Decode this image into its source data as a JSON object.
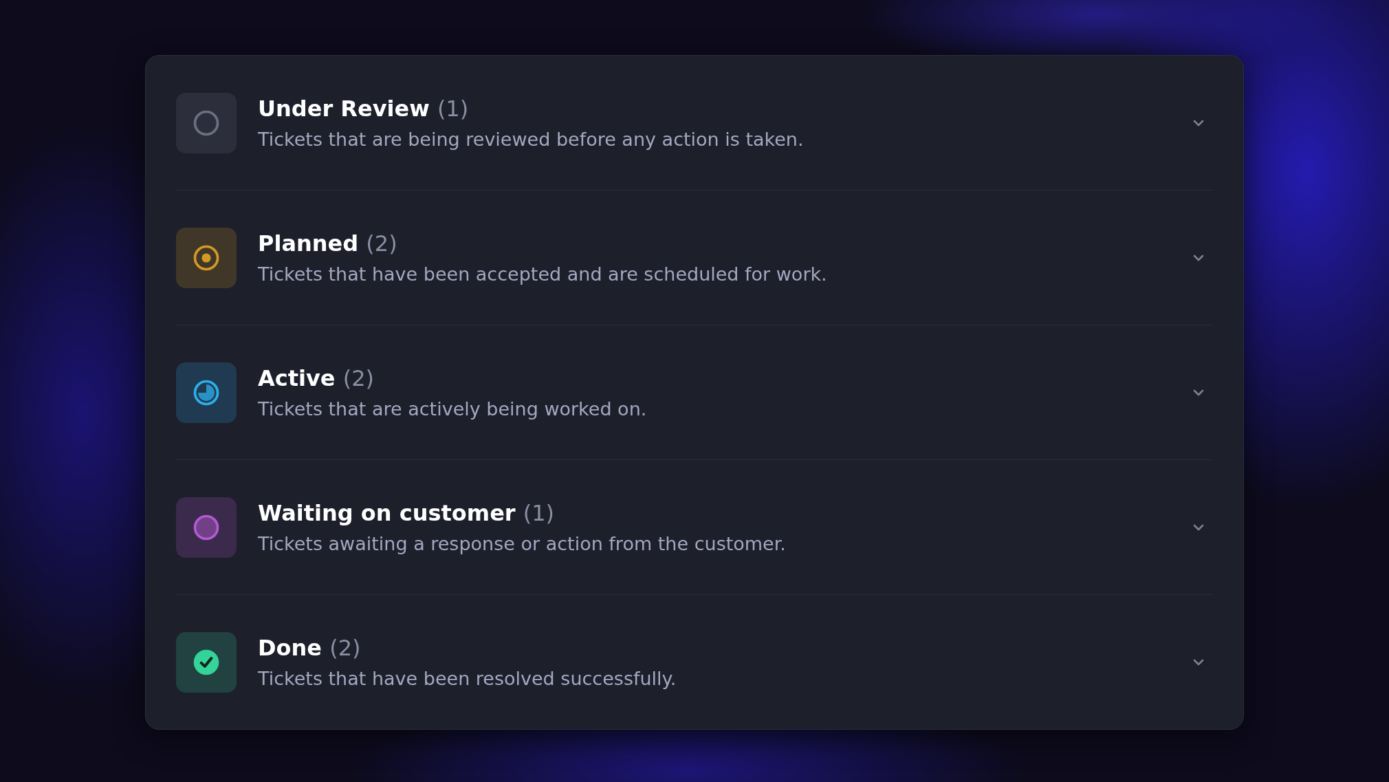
{
  "statuses": [
    {
      "kind": "ring",
      "color": "#6b7080",
      "title": "Under Review",
      "count": "(1)",
      "description": "Tickets that are being reviewed before any action is taken."
    },
    {
      "kind": "target",
      "color": "#d29a25",
      "title": "Planned",
      "count": "(2)",
      "description": "Tickets that have been accepted and are scheduled for work."
    },
    {
      "kind": "pie",
      "color": "#2bb0ec",
      "title": "Active",
      "count": "(2)",
      "description": "Tickets that are actively being worked on."
    },
    {
      "kind": "filled-ring",
      "color": "#b35ad0",
      "title": "Waiting on customer",
      "count": "(1)",
      "description": "Tickets awaiting a response or action from the customer."
    },
    {
      "kind": "check",
      "color": "#34d399",
      "title": "Done",
      "count": "(2)",
      "description": "Tickets that have been resolved successfully."
    }
  ]
}
